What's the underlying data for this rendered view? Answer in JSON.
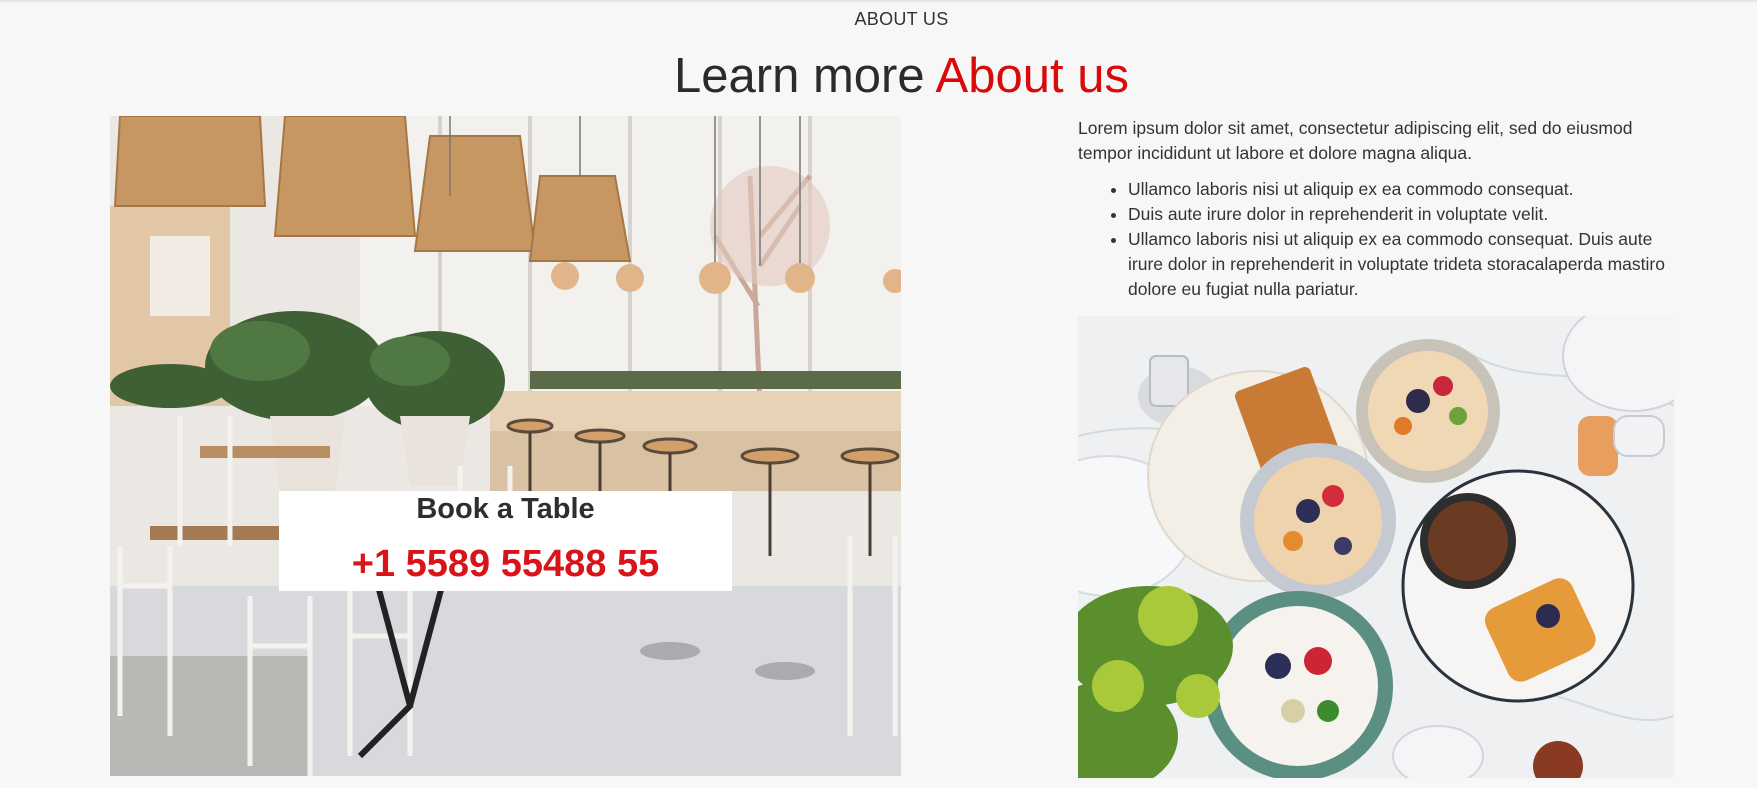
{
  "section": {
    "eyebrow": "ABOUT US",
    "title_main": "Learn more",
    "title_accent": "About us"
  },
  "booking": {
    "title": "Book a Table",
    "phone": "+1 5589 55488 55"
  },
  "about": {
    "intro": "Lorem ipsum dolor sit amet, consectetur adipiscing elit, sed do eiusmod tempor incididunt ut labore et dolore magna aliqua.",
    "bullets": [
      "Ullamco laboris nisi ut aliquip ex ea commodo consequat.",
      "Duis aute irure dolor in reprehenderit in voluptate velit.",
      "Ullamco laboris nisi ut aliquip ex ea commodo consequat. Duis aute irure dolor in reprehenderit in voluptate trideta storacalaperda mastiro dolore eu fugiat nulla pariatur."
    ]
  },
  "colors": {
    "accent": "#d90a0a",
    "background": "#f7f7f7"
  },
  "icons": {
    "bullet": "disc-bullet"
  }
}
